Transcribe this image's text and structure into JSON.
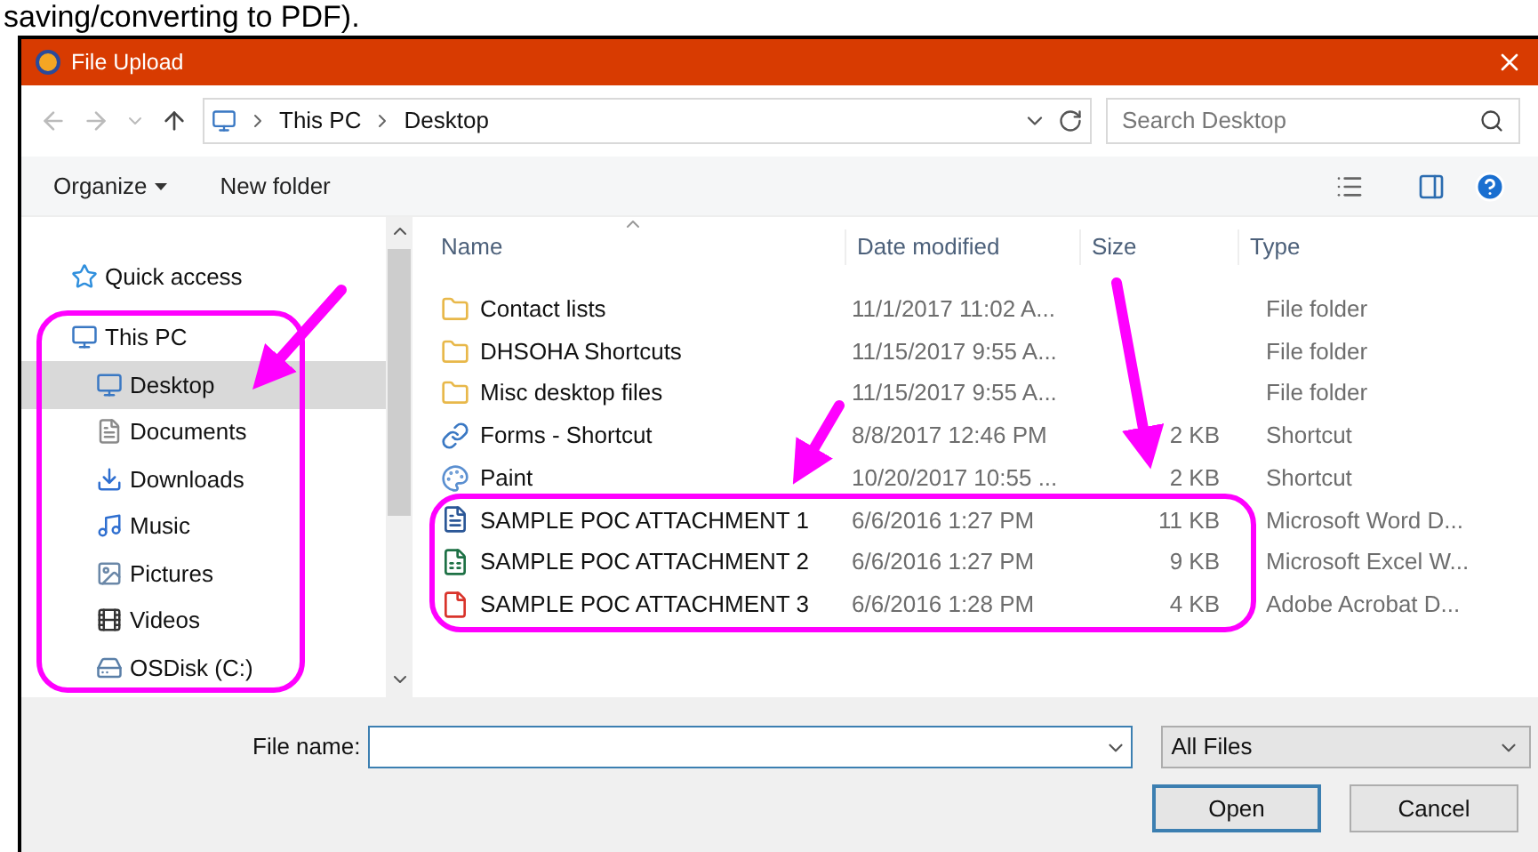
{
  "caption": "saving/converting to PDF).",
  "window": {
    "title": "File Upload"
  },
  "address": {
    "path": [
      "This PC",
      "Desktop"
    ],
    "search_placeholder": "Search Desktop"
  },
  "toolbar": {
    "organize": "Organize",
    "new_folder": "New folder"
  },
  "nav": [
    {
      "label": "Quick access",
      "kind": "star",
      "selected": false
    },
    {
      "label": "This PC",
      "kind": "pc",
      "selected": false,
      "children": [
        {
          "label": "Desktop",
          "kind": "desktop",
          "selected": true
        },
        {
          "label": "Documents",
          "kind": "documents",
          "selected": false
        },
        {
          "label": "Downloads",
          "kind": "downloads",
          "selected": false
        },
        {
          "label": "Music",
          "kind": "music",
          "selected": false
        },
        {
          "label": "Pictures",
          "kind": "pictures",
          "selected": false
        },
        {
          "label": "Videos",
          "kind": "videos",
          "selected": false
        },
        {
          "label": "OSDisk (C:)",
          "kind": "disk",
          "selected": false
        }
      ]
    }
  ],
  "columns": [
    "Name",
    "Date modified",
    "Size",
    "Type"
  ],
  "files": [
    {
      "name": "Contact lists",
      "kind": "folder",
      "date": "11/1/2017 11:02 A...",
      "type": "File folder"
    },
    {
      "name": "DHSOHA Shortcuts",
      "kind": "folder",
      "date": "11/15/2017 9:55 A...",
      "type": "File folder"
    },
    {
      "name": "Misc desktop files",
      "kind": "folder",
      "date": "11/15/2017 9:55 A...",
      "type": "File folder"
    },
    {
      "name": "Forms - Shortcut",
      "kind": "shortcut",
      "date": "8/8/2017 12:46 PM",
      "size": "2 KB",
      "type": "Shortcut"
    },
    {
      "name": "Paint",
      "kind": "paint",
      "date": "10/20/2017 10:55 ...",
      "size": "2 KB",
      "type": "Shortcut"
    },
    {
      "name": "SAMPLE POC ATTACHMENT 1",
      "kind": "word",
      "date": "6/6/2016 1:27 PM",
      "size": "11 KB",
      "type": "Microsoft Word D..."
    },
    {
      "name": "SAMPLE POC ATTACHMENT 2",
      "kind": "excel",
      "date": "6/6/2016 1:27 PM",
      "size": "9 KB",
      "type": "Microsoft Excel W..."
    },
    {
      "name": "SAMPLE POC ATTACHMENT 3",
      "kind": "pdf",
      "date": "6/6/2016 1:28 PM",
      "size": "4 KB",
      "type": "Adobe Acrobat D..."
    }
  ],
  "footer": {
    "file_name_label": "File name:",
    "filter": "All Files",
    "open": "Open",
    "cancel": "Cancel"
  }
}
